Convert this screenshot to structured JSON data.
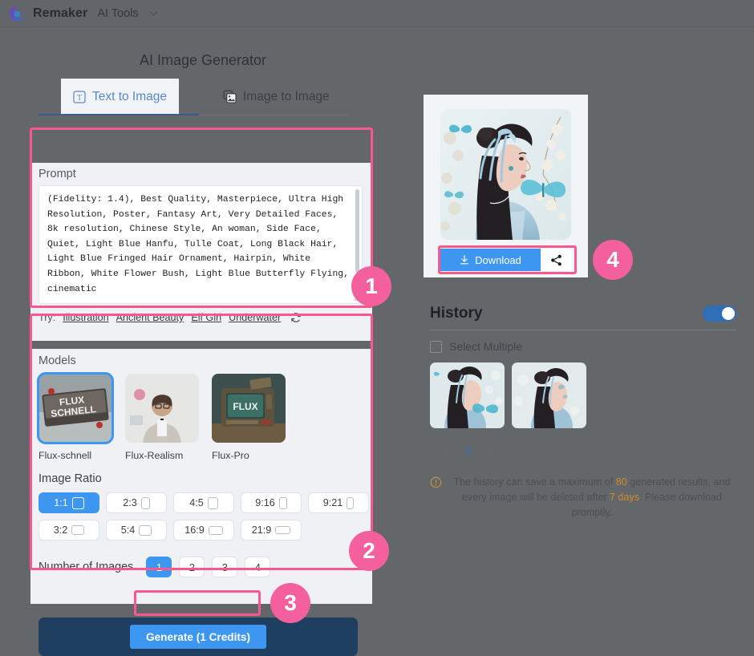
{
  "header": {
    "brand": "Remaker",
    "menu": "AI Tools",
    "logo_icon": "remaker-swirl-logo",
    "chevron_icon": "chevron-down-icon"
  },
  "left": {
    "title": "AI Image Generator",
    "tabs": [
      {
        "label": "Text to Image",
        "icon": "text-t-icon",
        "active": true
      },
      {
        "label": "Image to Image",
        "icon": "images-stack-icon",
        "active": false
      }
    ],
    "prompt": {
      "label": "Prompt",
      "value": "(Fidelity: 1.4), Best Quality, Masterpiece, Ultra High Resolution, Poster, Fantasy Art, Very Detailed Faces, 8k resolution, Chinese Style, An woman, Side Face, Quiet, Light Blue Hanfu, Tulle Coat, Long Black Hair, Light Blue Fringed Hair Ornament, Hairpin, White Ribbon, White Flower Bush, Light Blue Butterfly Flying, cinematic",
      "try_label": "Try:",
      "try_links": [
        "Illustration",
        "Ancient Beauty",
        "Elf Girl",
        "Underwater"
      ],
      "refresh_icon": "refresh-icon"
    },
    "models": {
      "label": "Models",
      "items": [
        {
          "name": "Flux-schnell",
          "selected": true
        },
        {
          "name": "Flux-Realism",
          "selected": false
        },
        {
          "name": "Flux-Pro",
          "selected": false
        }
      ]
    },
    "image_ratio": {
      "label": "Image Ratio",
      "options": [
        {
          "label": "1:1",
          "w": 13,
          "h": 13,
          "selected": true
        },
        {
          "label": "2:3",
          "w": 9,
          "h": 13,
          "selected": false
        },
        {
          "label": "4:5",
          "w": 11,
          "h": 13,
          "selected": false
        },
        {
          "label": "9:16",
          "w": 8,
          "h": 13,
          "selected": false
        },
        {
          "label": "9:21",
          "w": 7,
          "h": 13,
          "selected": false
        },
        {
          "label": "3:2",
          "w": 14,
          "h": 10,
          "selected": false
        },
        {
          "label": "5:4",
          "w": 14,
          "h": 11,
          "selected": false
        },
        {
          "label": "16:9",
          "w": 16,
          "h": 9,
          "selected": false
        },
        {
          "label": "21:9",
          "w": 17,
          "h": 8,
          "selected": false
        }
      ]
    },
    "number_of_images": {
      "label": "Number of Images",
      "options": [
        "1",
        "2",
        "3",
        "4"
      ],
      "selected": "1"
    },
    "generate_button": "Generate (1 Credits)"
  },
  "right": {
    "result": {
      "download_label": "Download",
      "download_icon": "download-icon",
      "share_icon": "share-icon",
      "image_alt": "generated-portrait-hanfu-woman"
    },
    "history": {
      "title": "History",
      "toggle_on": true,
      "select_multiple_label": "Select Multiple",
      "thumbnails": [
        "history-thumb-1",
        "history-thumb-2"
      ],
      "pagination": {
        "prev_icon": "chevron-left-icon",
        "page": "1",
        "next_icon": "chevron-right-icon"
      },
      "notice": {
        "icon": "info-circle-icon",
        "part1": "The history can save a maximum of ",
        "max": "80",
        "part2": " generated results, and every image will be deleted after ",
        "days": "7 days",
        "part3": ". Please download promptly."
      }
    }
  },
  "step_badges": [
    "1",
    "2",
    "3",
    "4"
  ],
  "colors": {
    "accent_blue": "#3d96f0",
    "highlight_pink": "#f8588e",
    "badge_pink": "#f4609e",
    "amber": "#d08a2a",
    "dark_blue": "#1f3f60"
  }
}
